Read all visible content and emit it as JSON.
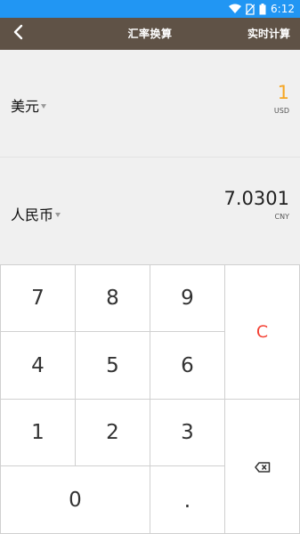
{
  "status_bar": {
    "time": "6:12",
    "icons": [
      "wifi-icon",
      "no-sim-icon",
      "battery-icon"
    ]
  },
  "app_bar": {
    "back_icon": "back-arrow-icon",
    "title": "汇率换算",
    "action_label": "实时计算"
  },
  "currencies": [
    {
      "name": "美元",
      "amount": "1",
      "code": "USD",
      "amount_color": "#f5a623"
    },
    {
      "name": "人民币",
      "amount": "7.0301",
      "code": "CNY",
      "amount_color": "#222222"
    }
  ],
  "keypad": {
    "digits": [
      "7",
      "8",
      "9",
      "4",
      "5",
      "6",
      "1",
      "2",
      "3",
      "0",
      "."
    ],
    "clear_label": "C",
    "clear_color": "#f44336",
    "backspace_icon": "backspace-icon"
  },
  "colors": {
    "status_bar": "#2196f3",
    "app_bar": "#5f5246",
    "currency_background": "#f0f0f0"
  }
}
